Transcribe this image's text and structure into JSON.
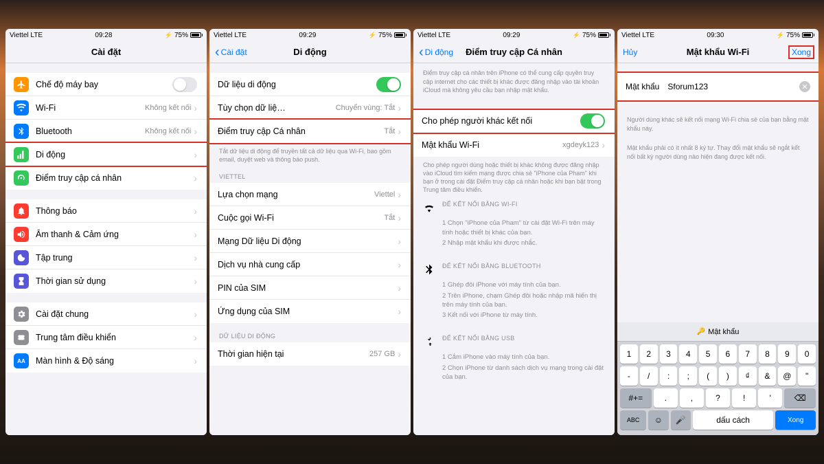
{
  "status": {
    "carrier": "Viettel LTE",
    "t1": "09:28",
    "t2": "09:29",
    "t3": "09:29",
    "t4": "09:30",
    "batt": "75%"
  },
  "s1": {
    "title": "Cài đặt",
    "r": [
      {
        "l": "Chế độ máy bay",
        "tog": false,
        "c": "#ff9500",
        "icon": "airplane"
      },
      {
        "l": "Wi-Fi",
        "v": "Không kết nối",
        "c": "#007aff",
        "icon": "wifi"
      },
      {
        "l": "Bluetooth",
        "v": "Không kết nối",
        "c": "#007aff",
        "icon": "bluetooth"
      },
      {
        "l": "Di động",
        "c": "#34c759",
        "icon": "cellular",
        "hl": true
      },
      {
        "l": "Điểm truy cập cá nhân",
        "c": "#34c759",
        "icon": "hotspot"
      },
      {
        "l": "Thông báo",
        "c": "#ff3b30",
        "icon": "bell"
      },
      {
        "l": "Âm thanh & Cảm ứng",
        "c": "#ff3b30",
        "icon": "speaker"
      },
      {
        "l": "Tập trung",
        "c": "#5856d6",
        "icon": "moon"
      },
      {
        "l": "Thời gian sử dụng",
        "c": "#5856d6",
        "icon": "hourglass"
      },
      {
        "l": "Cài đặt chung",
        "c": "#8e8e93",
        "icon": "gear"
      },
      {
        "l": "Trung tâm điều khiển",
        "c": "#8e8e93",
        "icon": "switches"
      },
      {
        "l": "Màn hình & Độ sáng",
        "c": "#007aff",
        "icon": "aa"
      }
    ]
  },
  "s2": {
    "back": "Cài đặt",
    "title": "Di động",
    "g1": [
      {
        "l": "Dữ liệu di động",
        "tog": true
      },
      {
        "l": "Tùy chọn dữ liệ…",
        "v": "Chuyển vùng: Tắt"
      },
      {
        "l": "Điểm truy cập Cá nhân",
        "v": "Tắt",
        "hl": true
      }
    ],
    "f1": "Tắt dữ liệu di động để truyền tất cả dữ liệu qua Wi-Fi, bao gồm email, duyệt web và thông báo push.",
    "h2": "VIETTEL",
    "g2": [
      {
        "l": "Lựa chọn mạng",
        "v": "Viettel"
      },
      {
        "l": "Cuộc gọi Wi-Fi",
        "v": "Tắt"
      },
      {
        "l": "Mạng Dữ liệu Di động"
      },
      {
        "l": "Dịch vụ nhà cung cấp"
      },
      {
        "l": "PIN của SIM"
      },
      {
        "l": "Ứng dụng của SIM"
      }
    ],
    "h3": "DỮ LIỆU DI ĐỘNG",
    "g3": [
      {
        "l": "Thời gian hiện tại",
        "v": "257 GB"
      }
    ]
  },
  "s3": {
    "back": "Di động",
    "title": "Điểm truy cập Cá nhân",
    "intro": "Điểm truy cập cá nhân trên iPhone có thể cung cấp quyền truy cập internet cho các thiết bị khác được đăng nhập vào tài khoản iCloud mà không yêu cầu bạn nhập mật khẩu.",
    "g1": [
      {
        "l": "Cho phép người khác kết nối",
        "tog": true,
        "hl": true
      },
      {
        "l": "Mật khẩu Wi-Fi",
        "v": "xgdeyk123"
      }
    ],
    "f1": "Cho phép người dùng hoặc thiết bị khác không được đăng nhập vào iCloud tìm kiếm mạng được chia sẻ \"iPhone của Pham\" khi bạn ở trong cài đặt Điểm truy cập cá nhân hoặc khi bạn bật trong Trung tâm điều khiển.",
    "wifi": {
      "t": "ĐỂ KẾT NỐI BẰNG WI-FI",
      "s": [
        "1 Chọn \"iPhone của Pham\" từ cài đặt Wi-Fi trên máy tính hoặc thiết bị khác của bạn.",
        "2 Nhập mật khẩu khi được nhắc."
      ]
    },
    "bt": {
      "t": "ĐỂ KẾT NỐI BẰNG BLUETOOTH",
      "s": [
        "1 Ghép đôi iPhone với máy tính của bạn.",
        "2 Trên iPhone, chạm Ghép đôi hoặc nhập mã hiển thị trên máy tính của bạn.",
        "3 Kết nối với iPhone từ máy tính."
      ]
    },
    "usb": {
      "t": "ĐỂ KẾT NỐI BẰNG USB",
      "s": [
        "1 Cắm iPhone vào máy tính của bạn.",
        "2 Chọn iPhone từ danh sách dịch vụ mạng trong cài đặt của bạn."
      ]
    }
  },
  "s4": {
    "cancel": "Hủy",
    "title": "Mật khẩu Wi-Fi",
    "done": "Xong",
    "plabel": "Mật khẩu",
    "pval": "Sforum123",
    "f1": "Người dùng khác sẽ kết nối mạng Wi-Fi chia sẻ của bạn bằng mật khẩu này.",
    "f2": "Mật khẩu phải có ít nhất 8 ký tự. Thay đổi mật khẩu sẽ ngắt kết nối bất kỳ người dùng nào hiện đang được kết nối.",
    "sugg": "Mật khẩu",
    "k1": [
      "1",
      "2",
      "3",
      "4",
      "5",
      "6",
      "7",
      "8",
      "9",
      "0"
    ],
    "k2": [
      "-",
      "/",
      ":",
      ";",
      "(",
      ")",
      "₫",
      "&",
      "@",
      "\""
    ],
    "k3": [
      ".",
      ",",
      "?",
      "!",
      "'"
    ],
    "sh": "#+=",
    "abc": "ABC",
    "sp": "dấu cách",
    "dn": "Xong"
  }
}
